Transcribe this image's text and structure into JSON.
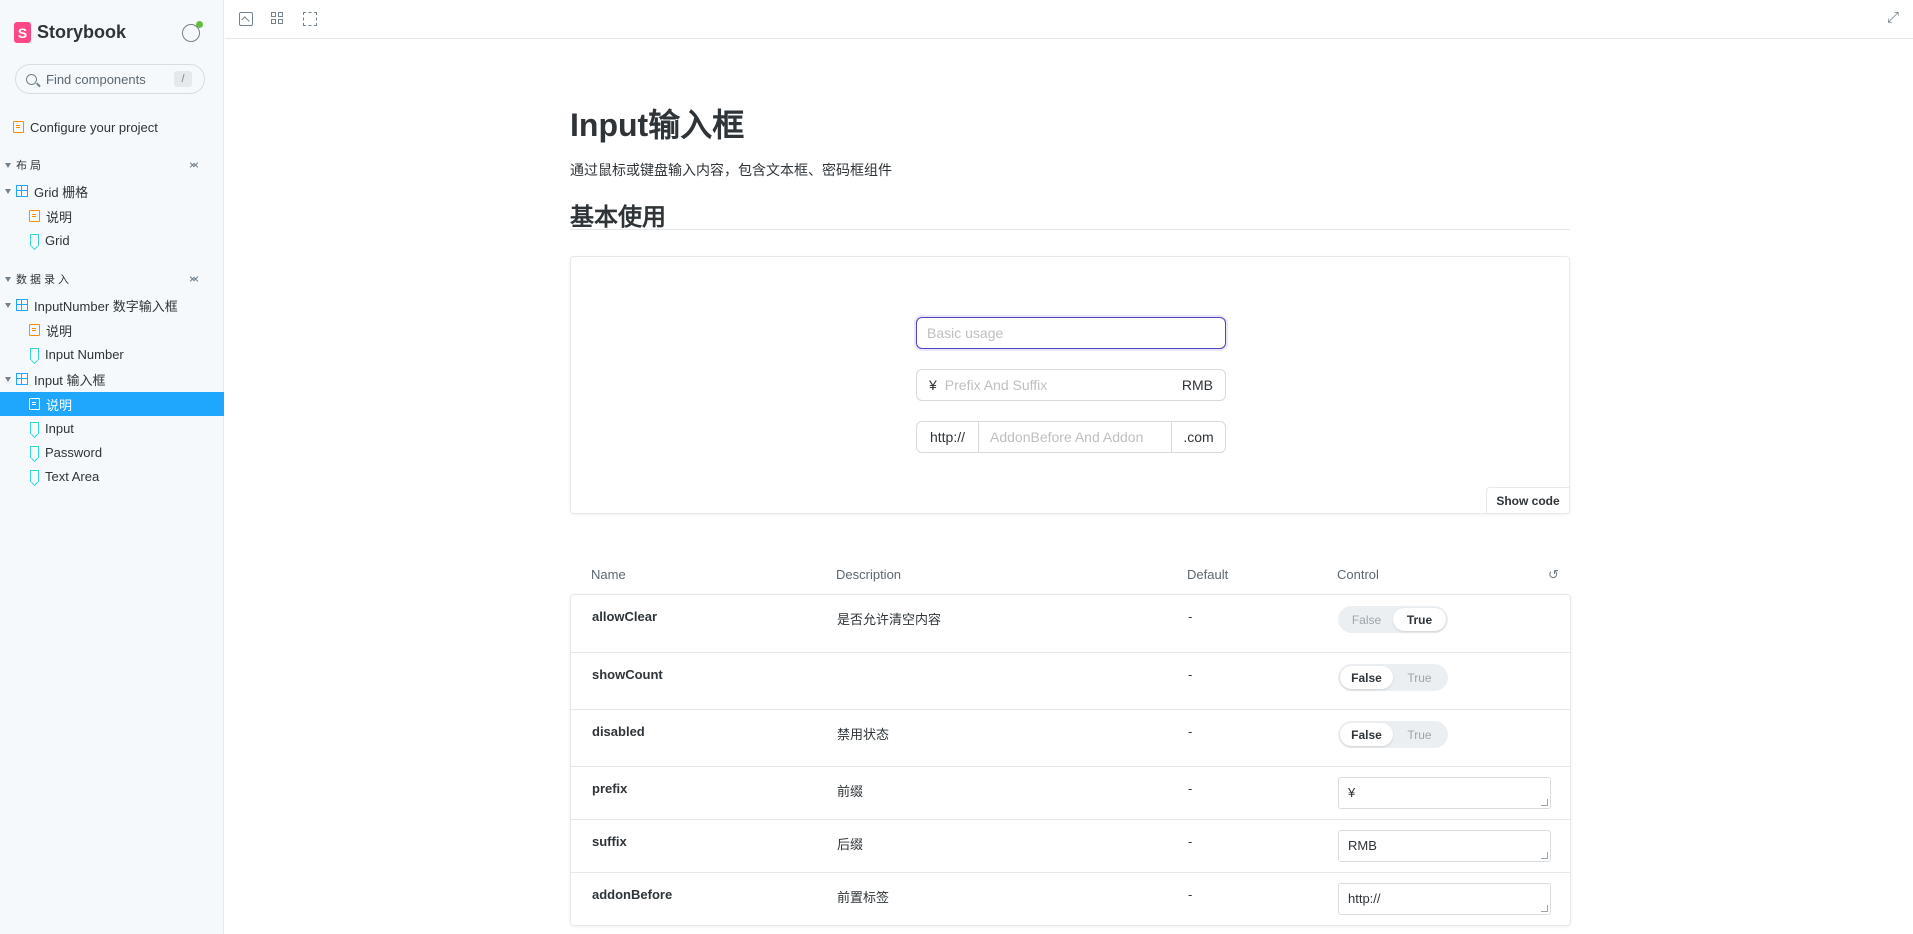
{
  "app": {
    "brand": "Storybook",
    "brand_letter": "S"
  },
  "sidebar": {
    "search_placeholder": "Find components",
    "search_shortcut": "/",
    "configure": "Configure your project",
    "group_layout": "布局",
    "grid_component": "Grid 栅格",
    "grid_docs": "说明",
    "grid_story": "Grid",
    "group_data_entry": "数据录入",
    "inputnumber_component": "InputNumber 数字输入框",
    "inputnumber_docs": "说明",
    "inputnumber_story": "Input Number",
    "input_component": "Input 输入框",
    "input_docs": "说明",
    "input_story": "Input",
    "password_story": "Password",
    "textarea_story": "Text Area"
  },
  "main": {
    "title": "Input输入框",
    "description": "通过鼠标或键盘输入内容，包含文本框、密码框组件",
    "section_title": "基本使用",
    "demo": {
      "basic_placeholder": "Basic usage",
      "prefix": "¥",
      "prefix_suffix_placeholder": "Prefix And Suffix",
      "suffix": "RMB",
      "addon_before": "http://",
      "addon_placeholder": "AddonBefore And Addon",
      "addon_after": ".com",
      "show_code": "Show code"
    },
    "args": {
      "headers": {
        "name": "Name",
        "description": "Description",
        "default": "Default",
        "control": "Control"
      },
      "toggle_false": "False",
      "toggle_true": "True",
      "rows": [
        {
          "name": "allowClear",
          "description": "是否允许清空内容",
          "default": "-",
          "control": "boolean",
          "value": true
        },
        {
          "name": "showCount",
          "description": "",
          "default": "-",
          "control": "boolean",
          "value": false
        },
        {
          "name": "disabled",
          "description": "禁用状态",
          "default": "-",
          "control": "boolean",
          "value": false
        },
        {
          "name": "prefix",
          "description": "前缀",
          "default": "-",
          "control": "text",
          "value": "¥"
        },
        {
          "name": "suffix",
          "description": "后缀",
          "default": "-",
          "control": "text",
          "value": "RMB"
        },
        {
          "name": "addonBefore",
          "description": "前置标签",
          "default": "-",
          "control": "text",
          "value": "http://"
        }
      ]
    }
  },
  "colors": {
    "accent": "#1ea7fd",
    "brand": "#ff4785",
    "focus": "#4d44c4"
  }
}
